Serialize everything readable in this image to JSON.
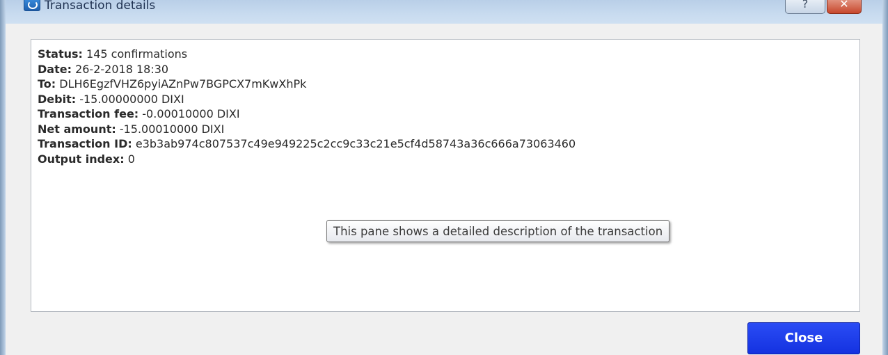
{
  "window": {
    "title": "Transaction details",
    "help_label": "?",
    "close_label": "✕"
  },
  "details": [
    {
      "key": "Status:",
      "value": " 145 confirmations"
    },
    {
      "key": "Date:",
      "value": " 26-2-2018 18:30"
    },
    {
      "key": "To:",
      "value": " DLH6EgzfVHZ6pyiAZnPw7BGPCX7mKwXhPk"
    },
    {
      "key": "Debit:",
      "value": " -15.00000000 DIXI"
    },
    {
      "key": "Transaction fee:",
      "value": " -0.00010000 DIXI"
    },
    {
      "key": "Net amount:",
      "value": " -15.00010000 DIXI"
    },
    {
      "key": "Transaction ID:",
      "value": " e3b3ab974c807537c49e949225c2cc9c33c21e5cf4d58743a36c666a73063460"
    },
    {
      "key": "Output index:",
      "value": " 0"
    }
  ],
  "tooltip": "This pane shows a detailed description of the transaction",
  "buttons": {
    "close_label": "Close"
  },
  "colors": {
    "close_button": "#1a3ff0",
    "titlebar": "#c8dbef"
  }
}
